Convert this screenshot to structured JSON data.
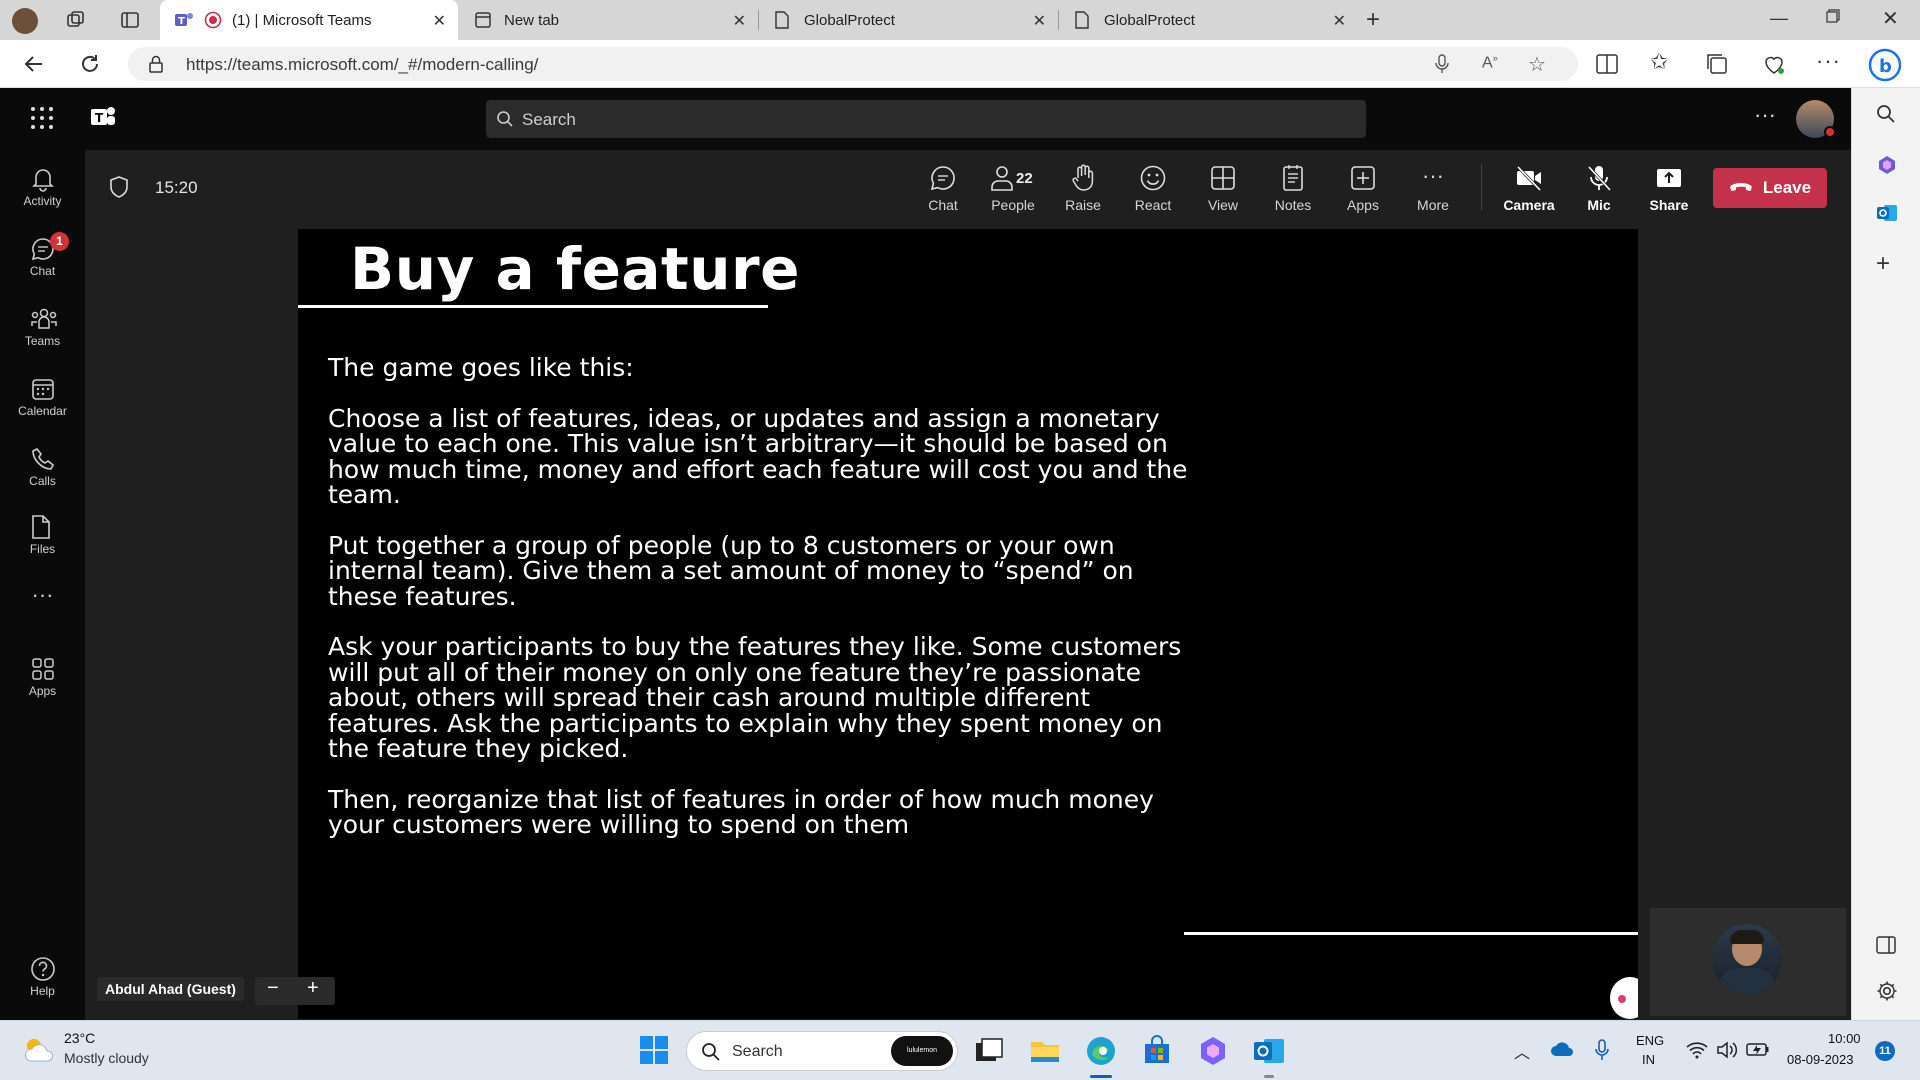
{
  "browser": {
    "tabs": [
      {
        "label": "(1) | Microsoft Teams",
        "active": true
      },
      {
        "label": "New tab",
        "active": false
      },
      {
        "label": "GlobalProtect",
        "active": false
      },
      {
        "label": "GlobalProtect",
        "active": false
      }
    ],
    "url": "https://teams.microsoft.com/_#/modern-calling/"
  },
  "teams": {
    "search_placeholder": "Search",
    "rail": [
      {
        "label": "Activity",
        "icon": "bell-icon"
      },
      {
        "label": "Chat",
        "icon": "chat-icon",
        "badge": "1"
      },
      {
        "label": "Teams",
        "icon": "teams-icon"
      },
      {
        "label": "Calendar",
        "icon": "calendar-icon"
      },
      {
        "label": "Calls",
        "icon": "phone-icon"
      },
      {
        "label": "Files",
        "icon": "file-icon"
      },
      {
        "label": "",
        "icon": "more-icon"
      },
      {
        "label": "Apps",
        "icon": "apps-icon"
      },
      {
        "label": "Help",
        "icon": "help-icon"
      }
    ]
  },
  "meeting": {
    "timer": "15:20",
    "toolbar": {
      "chat": "Chat",
      "people": "People",
      "people_count": "22",
      "raise": "Raise",
      "react": "React",
      "view": "View",
      "notes": "Notes",
      "apps": "Apps",
      "more": "More",
      "camera": "Camera",
      "mic": "Mic",
      "share": "Share",
      "leave": "Leave"
    },
    "presenter": "Abdul Ahad (Guest)"
  },
  "slide": {
    "title": "Buy a feature",
    "paragraphs": [
      "The game goes like this:",
      "Choose a list of features, ideas, or updates and assign a monetary value to each one. This value isn’t arbitrary—it should be based on how much time, money and effort each feature will cost you and the team.",
      "Put together a group of people (up to 8 customers or your own internal team). Give them a set amount of money to “spend” on these features.",
      "Ask your participants to buy the features they like. Some customers will put all of their money on only one feature they’re passionate about, others will spread their cash around multiple different features. Ask the participants to explain why they spent money on the feature they picked.",
      "Then, reorganize that list of features in order of how much money your customers were willing to spend on them"
    ]
  },
  "taskbar": {
    "temperature": "23°C",
    "weather": "Mostly cloudy",
    "search": "Search",
    "pinned_label": "lululemon",
    "lang": "ENG",
    "region": "IN",
    "time": "10:00",
    "date": "08-09-2023",
    "notifications": "11"
  },
  "colors": {
    "leave": "#c4314b",
    "teams_purple": "#5b5fc7",
    "badge": "#d13438"
  }
}
